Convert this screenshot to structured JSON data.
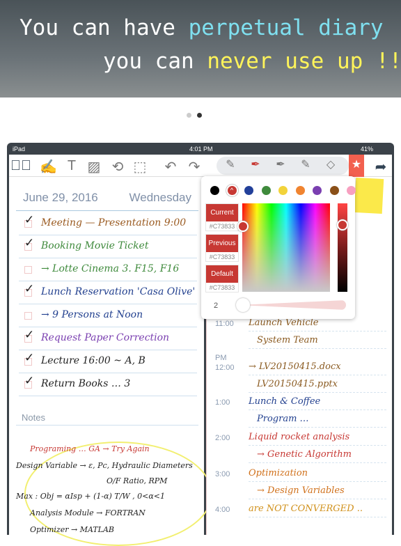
{
  "banner": {
    "line1a": "You can have ",
    "line1b": "perpetual diary",
    "line2a": "you can ",
    "line2b": "never use up !!"
  },
  "status": {
    "device": "iPad",
    "time": "4:01 PM",
    "battery": "41%"
  },
  "diary": {
    "date": "June 29, 2016",
    "weekday": "Wednesday",
    "tasks": [
      {
        "text": "Meeting — Presentation 9:00",
        "checked": true,
        "color": "#9a5a20"
      },
      {
        "text": "Booking Movie Ticket",
        "checked": true,
        "color": "#3f8a3c"
      },
      {
        "text": "→ Lotte Cinema 3. F15, F16",
        "checked": false,
        "color": "#3f8a3c"
      },
      {
        "text": "Lunch Reservation 'Casa Olive'",
        "checked": true,
        "color": "#22408f"
      },
      {
        "text": "→ 9 Persons at Noon",
        "checked": false,
        "color": "#22408f"
      },
      {
        "text": "Request Paper Correction",
        "checked": true,
        "color": "#7a3fb0"
      },
      {
        "text": "Lecture 16:00 ~ A, B",
        "checked": true,
        "color": "#222222"
      },
      {
        "text": "Return Books … 3",
        "checked": true,
        "color": "#222222"
      }
    ],
    "notes_label": "Notes",
    "notes": [
      "Programing … GA → Try Again",
      "Design Variable → ε, Pc, Hydraulic Diameters",
      "O/F Ratio, RPM",
      "Max : Obj = αIsp + (1-α) T/W , 0<α<1",
      "Analysis Module → FORTRAN",
      "Optimizer → MATLAB"
    ]
  },
  "schedule": {
    "pm_label": "PM",
    "entries": [
      {
        "time": "11:00",
        "lines": [
          "Launch Vehicle",
          "System Team"
        ],
        "color": "#8a5a20"
      },
      {
        "time": "12:00",
        "lines": [
          "→ LV20150415.docx",
          "LV20150415.pptx"
        ],
        "color": "#8a5a20"
      },
      {
        "time": "1:00",
        "lines": [
          "Lunch & Coffee",
          "Program …"
        ],
        "color": "#22408f"
      },
      {
        "time": "2:00",
        "lines": [
          "Liquid rocket analysis",
          "→ Genetic Algorithm"
        ],
        "color": "#c73833"
      },
      {
        "time": "3:00",
        "lines": [
          "Optimization",
          "→ Design Variables"
        ],
        "color": "#d0701a"
      },
      {
        "time": "4:00",
        "lines": [
          "are NOT CONVERGED .."
        ],
        "color": "#d0901a"
      }
    ]
  },
  "picker": {
    "swatches": [
      "#000000",
      "#c73833",
      "#22409a",
      "#3f8a3c",
      "#f2d33a",
      "#f08430",
      "#7a3fb0",
      "#8a5018",
      "#f7a0c0"
    ],
    "current_label": "Current",
    "current_hex": "#C73833",
    "previous_label": "Previous",
    "previous_hex": "#C73833",
    "default_label": "Default",
    "default_hex": "#C73833",
    "size": "2"
  },
  "colors": {
    "accent": "#c73833",
    "favorite": "#f2604f"
  }
}
